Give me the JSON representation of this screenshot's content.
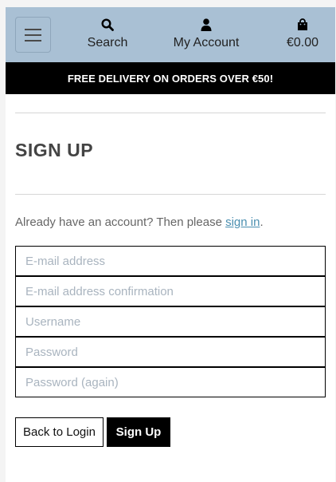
{
  "header": {
    "menu_icon": "hamburger-icon",
    "nav": {
      "search": {
        "label": "Search",
        "icon": "search-icon"
      },
      "account": {
        "label": "My Account",
        "icon": "user-icon"
      },
      "bag": {
        "label": "€0.00",
        "icon": "shopping-bag-icon"
      }
    },
    "bar_color": "#a9c0d4"
  },
  "promo": {
    "text": "FREE DELIVERY ON ORDERS OVER €50!"
  },
  "main": {
    "title": "SIGN UP",
    "intro_prefix": "Already have an account? Then please ",
    "intro_link": "sign in",
    "intro_suffix": ".",
    "link_color": "#4b8fb0"
  },
  "form": {
    "email": {
      "placeholder": "E-mail address",
      "value": ""
    },
    "email_confirm": {
      "placeholder": "E-mail address confirmation",
      "value": ""
    },
    "username": {
      "placeholder": "Username",
      "value": ""
    },
    "password": {
      "placeholder": "Password",
      "value": ""
    },
    "password_again": {
      "placeholder": "Password (again)",
      "value": ""
    },
    "back_label": "Back to Login",
    "submit_label": "Sign Up"
  }
}
